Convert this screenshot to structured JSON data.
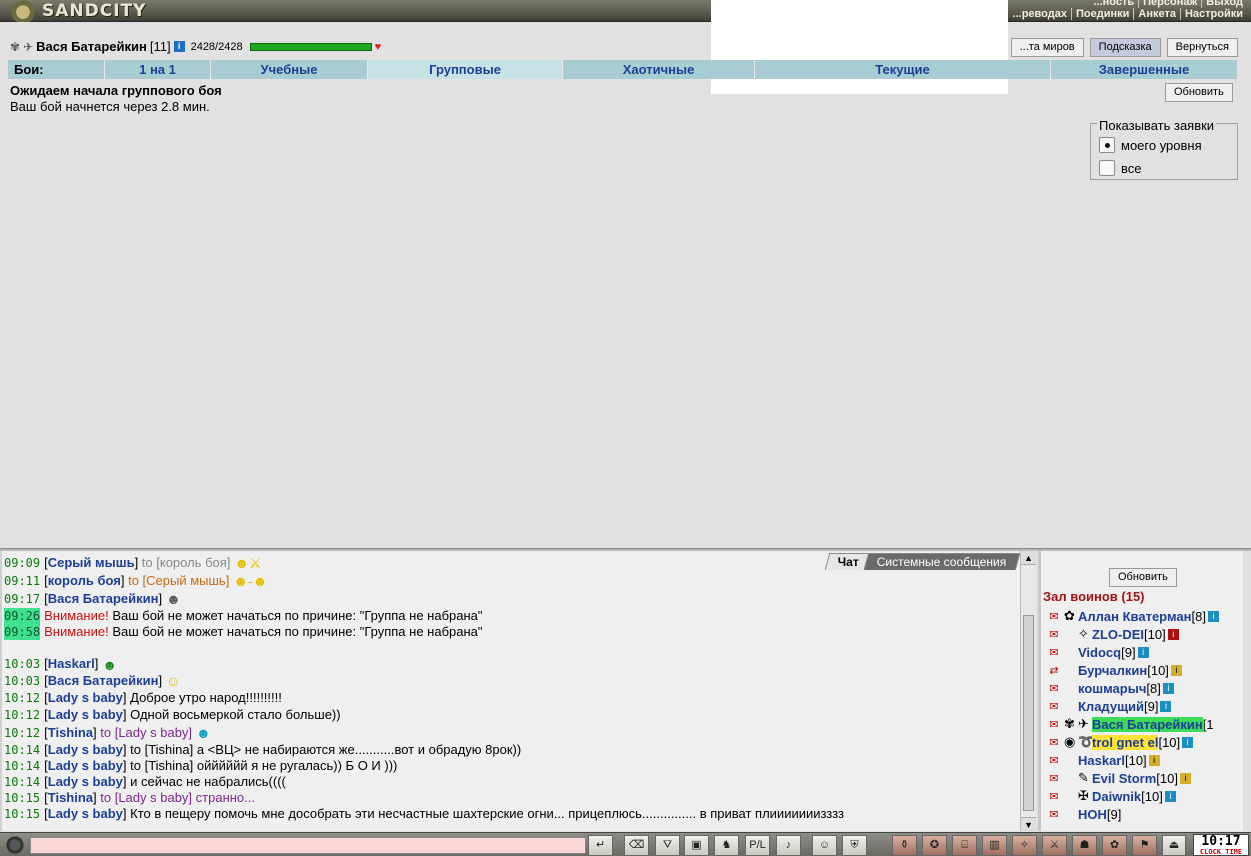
{
  "app": {
    "logo": "SANDCITY"
  },
  "topmenu": {
    "row1": [
      "...ность",
      "Персонаж",
      "Выход"
    ],
    "row2": [
      "...реводах",
      "Поединки",
      "Анкета",
      "Настройки"
    ]
  },
  "player": {
    "name": "Вася Батарейкин",
    "level": "[11]",
    "hp": "2428/2428"
  },
  "top_buttons": {
    "worlds": "...та миров",
    "hint": "Подсказка",
    "back": "Вернуться"
  },
  "tabs": {
    "head": "Бои:",
    "items": [
      "1 на 1",
      "Учебные",
      "Групповые",
      "Хаотичные",
      "Текущие",
      "Завершенные"
    ]
  },
  "status": {
    "title": "Ожидаем начала группового боя",
    "subtitle": "Ваш бой начнется через 2.8 мин.",
    "refresh": "Обновить"
  },
  "filter": {
    "legend": "Показывать заявки",
    "opt1": "моего уровня",
    "opt2": "все"
  },
  "chat_tabs": {
    "chat": "Чат",
    "system": "Системные сообщения"
  },
  "chat": [
    {
      "time": "09:09",
      "nick": "Серый мышь",
      "to": "to [король боя]"
    },
    {
      "time": "09:11",
      "nick": "король боя",
      "to": "to [Серый мышь]"
    },
    {
      "time": "09:17",
      "nick": "Вася Батарейкин"
    },
    {
      "time": "09:26",
      "warn": "Внимание!",
      "msg": "Ваш бой не может начаться по причине: \"Группа не набрана\""
    },
    {
      "time": "09:58",
      "warn": "Внимание!",
      "msg": "Ваш бой не может начаться по причине: \"Группа не набрана\""
    },
    {
      "time": "10:03",
      "nick": "Haskarl"
    },
    {
      "time": "10:03",
      "nick": "Вася Батарейкин"
    },
    {
      "time": "10:12",
      "nick": "Lady s baby",
      "msg": "Доброе утро народ!!!!!!!!!!"
    },
    {
      "time": "10:12",
      "nick": "Lady s baby",
      "msg": "Одной восьмеркой стало больше))"
    },
    {
      "time": "10:12",
      "nick": "Tishina",
      "to": "to [Lady s baby]"
    },
    {
      "time": "10:14",
      "nick": "Lady s baby",
      "msg": "to [Tishina] а <ВЦ> не набираются же...........вот и обрадую 8рок))"
    },
    {
      "time": "10:14",
      "nick": "Lady s baby",
      "msg": "to [Tishina] ойййййй я не ругалась)) Б О И )))"
    },
    {
      "time": "10:14",
      "nick": "Lady s baby",
      "msg": "и сейчас не набрались(((("
    },
    {
      "time": "10:15",
      "nick": "Tishina",
      "to": "to [Lady s baby] странно..."
    },
    {
      "time": "10:15",
      "nick": "Lady s baby",
      "msg": "Кто в пещеру помочь мне дособрать эти несчастные шахтерские огни... прицеплюсь............... в приват плииииииизззз"
    }
  ],
  "right": {
    "refresh": "Обновить",
    "hall": "Зал воинов (15)",
    "players": [
      {
        "name": "Аллан Кватерман",
        "lvl": "[8]"
      },
      {
        "name": "ZLO-DEI",
        "lvl": "[10]"
      },
      {
        "name": "Vidocq",
        "lvl": "[9]"
      },
      {
        "name": "Бурчалкин",
        "lvl": "[10]"
      },
      {
        "name": "кошмарыч",
        "lvl": "[8]"
      },
      {
        "name": "Кладущий",
        "lvl": "[9]"
      },
      {
        "name": "Вася Батарейкин",
        "lvl": "[1"
      },
      {
        "name": "trol gnet el",
        "lvl": "[10]"
      },
      {
        "name": "Haskarl",
        "lvl": "[10]"
      },
      {
        "name": "Evil Storm",
        "lvl": "[10]"
      },
      {
        "name": "Daiwnik",
        "lvl": "[10]"
      },
      {
        "name": "НОН",
        "lvl": "[9]"
      }
    ]
  },
  "clock": {
    "time": "10:17",
    "label": "CLOCK TIME"
  },
  "colors": {
    "tabs": "#a7cdd3",
    "active_tab": "#c8e3e6",
    "hp": "#1fa71f",
    "nick": "#1c3f94",
    "warn": "#c81010",
    "hall": "#a01414"
  }
}
